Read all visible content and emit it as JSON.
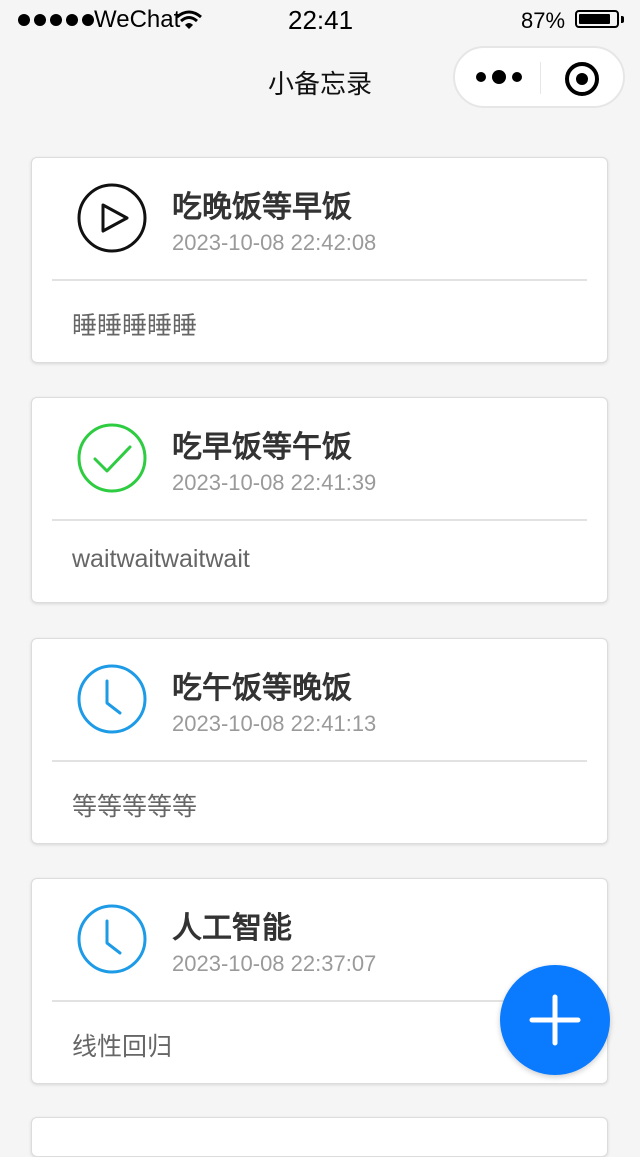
{
  "status_bar": {
    "carrier": "WeChat",
    "time": "22:41",
    "battery_percent": "87%",
    "battery_level": 0.87
  },
  "nav": {
    "title": "小备忘录"
  },
  "memos": [
    {
      "status": "play",
      "status_color": "#111111",
      "title": "吃晚饭等早饭",
      "time": "2023-10-08 22:42:08",
      "content": "睡睡睡睡睡"
    },
    {
      "status": "done",
      "status_color": "#2ecc40",
      "title": "吃早饭等午饭",
      "time": "2023-10-08 22:41:39",
      "content": "waitwaitwaitwait"
    },
    {
      "status": "pending",
      "status_color": "#1e9be6",
      "title": "吃午饭等晚饭",
      "time": "2023-10-08 22:41:13",
      "content": "等等等等等"
    },
    {
      "status": "pending",
      "status_color": "#1e9be6",
      "title": "人工智能",
      "time": "2023-10-08 22:37:07",
      "content": "线性回归"
    }
  ],
  "fab": {
    "icon": "plus-icon",
    "color": "#0a7bff"
  }
}
